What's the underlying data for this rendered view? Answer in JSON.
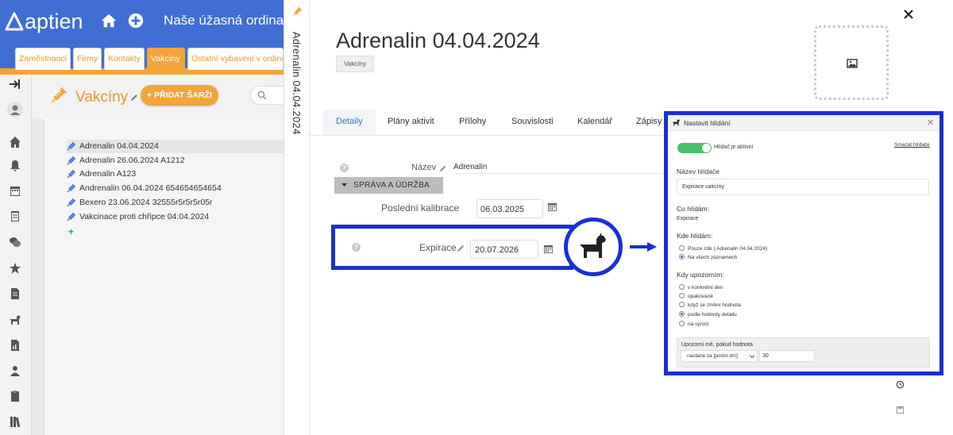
{
  "app": {
    "logo_text": "aptien",
    "clinic_name": "Naše úžasná ordinace",
    "tabs": [
      {
        "label": "Zaměstnanci",
        "active": false
      },
      {
        "label": "Firmy",
        "active": false
      },
      {
        "label": "Kontakty",
        "active": false
      },
      {
        "label": "Vakcíny",
        "active": true
      },
      {
        "label": "Ostatní vybavení v ordinaci",
        "active": false
      }
    ],
    "brand_blue": "#3f6ed3",
    "accent_orange": "#f4a43a"
  },
  "list": {
    "section_title": "Vakcíny",
    "add_batch_label": "+ PŘIDAT ŠARŽI",
    "items": [
      {
        "label": "Adrenalin 04.04.2024",
        "selected": true
      },
      {
        "label": "Adrenalin 26.06.2024 A1212",
        "selected": false
      },
      {
        "label": "Adrenalin A123",
        "selected": false
      },
      {
        "label": "Andrenalin 06.04.2024 654654654654",
        "selected": false
      },
      {
        "label": "Bexero 23.06.2024 32555r5r5r5r05r",
        "selected": false
      },
      {
        "label": "Vakcinace proti chřipce 04.04.2024",
        "selected": false
      }
    ],
    "add_item_glyph": "+"
  },
  "detail": {
    "vertical_title": "Adrenalin 04.04.2024",
    "title": "Adrenalin 04.04.2024",
    "badge": "Vakcíny",
    "close_glyph": "✕",
    "tabs": [
      {
        "label": "Detaily",
        "active": true
      },
      {
        "label": "Plány aktivit",
        "active": false
      },
      {
        "label": "Přílohy",
        "active": false
      },
      {
        "label": "Souvislosti",
        "active": false
      },
      {
        "label": "Kalendář",
        "active": false
      },
      {
        "label": "Zápisy",
        "active": false
      }
    ],
    "name_label": "Název",
    "name_value": "Adrenalin",
    "group_label": "SPRÁVA A ÚDRŽBA",
    "calibration_label": "Poslední kalibrace",
    "calibration_value": "06.03.2025",
    "expiry_label": "Expirace",
    "expiry_value": "20.07.2026",
    "help_glyph": "?",
    "highlight_color": "#1a2fd4"
  },
  "watch_dialog": {
    "title": "Nastavit hlídání",
    "close_glyph": "✕",
    "active_label": "Hlídač je aktivní",
    "active": true,
    "delete_label": "Smazat hlídače",
    "name_heading": "Název hlídače",
    "name_value": "Expirace vakcíny",
    "what_heading": "Co hlídám:",
    "what_value": "Expirace",
    "where_heading": "Kde hlídám:",
    "where_options": [
      {
        "label": "Pouze zde ( Adrenalin 04.04.2024)",
        "selected": false
      },
      {
        "label": "Na všech záznamech",
        "selected": true
      }
    ],
    "when_heading": "Kdy upozorním:",
    "when_options": [
      {
        "label": "v konkrétní den",
        "selected": false
      },
      {
        "label": "opakovaně",
        "selected": false
      },
      {
        "label": "když se změní hodnota",
        "selected": false
      },
      {
        "label": "podle hodnoty detailu",
        "selected": true
      },
      {
        "label": "na výročí",
        "selected": false
      }
    ],
    "notify_label": "Upozorni mě, pokud hodnota",
    "notify_select": "nastane za [počet dní]",
    "notify_value": "30",
    "toggle_color": "#48c26a"
  }
}
